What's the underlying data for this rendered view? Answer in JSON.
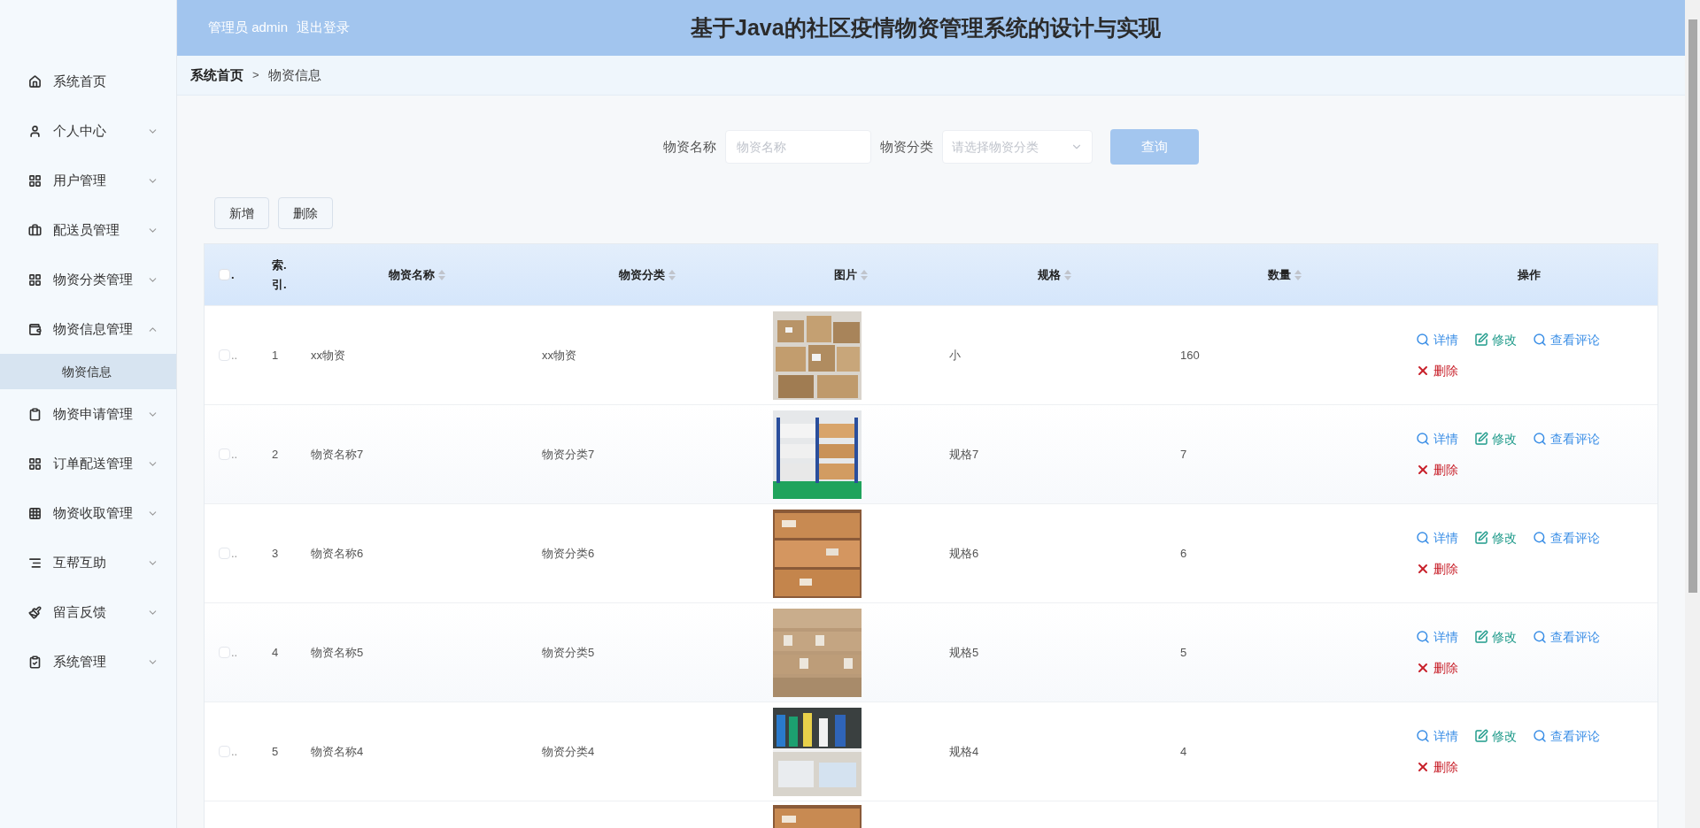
{
  "header": {
    "user_role": "管理员",
    "username": "admin",
    "logout": "退出登录",
    "title": "基于Java的社区疫情物资管理系统的设计与实现"
  },
  "sidebar": {
    "items": [
      {
        "label": "系统首页",
        "kind": "link"
      },
      {
        "label": "个人中心",
        "kind": "menu",
        "expanded": false
      },
      {
        "label": "用户管理",
        "kind": "menu",
        "expanded": false
      },
      {
        "label": "配送员管理",
        "kind": "menu",
        "expanded": false
      },
      {
        "label": "物资分类管理",
        "kind": "menu",
        "expanded": false
      },
      {
        "label": "物资信息管理",
        "kind": "menu",
        "expanded": true,
        "children": [
          {
            "label": "物资信息",
            "selected": true
          }
        ]
      },
      {
        "label": "物资申请管理",
        "kind": "menu",
        "expanded": false
      },
      {
        "label": "订单配送管理",
        "kind": "menu",
        "expanded": false
      },
      {
        "label": "物资收取管理",
        "kind": "menu",
        "expanded": false
      },
      {
        "label": "互帮互助",
        "kind": "menu",
        "expanded": false
      },
      {
        "label": "留言反馈",
        "kind": "menu",
        "expanded": false
      },
      {
        "label": "系统管理",
        "kind": "menu",
        "expanded": false
      }
    ]
  },
  "breadcrumb": {
    "home": "系统首页",
    "separator": ">",
    "current": "物资信息"
  },
  "search": {
    "name_label": "物资名称",
    "name_placeholder": "物资名称",
    "category_label": "物资分类",
    "category_placeholder": "请选择物资分类",
    "query_button": "查询"
  },
  "toolbar": {
    "buttons": [
      "新增",
      "删除"
    ]
  },
  "table": {
    "select_header": ".",
    "select_all_checked": false,
    "index_header_lines": [
      "索.",
      "引."
    ],
    "columns": [
      {
        "label": "物资名称",
        "sortable": true
      },
      {
        "label": "物资分类",
        "sortable": true
      },
      {
        "label": "图片",
        "sortable": true
      },
      {
        "label": "规格",
        "sortable": true
      },
      {
        "label": "数量",
        "sortable": true
      },
      {
        "label": "操作",
        "sortable": false
      }
    ],
    "rows": [
      {
        "checked": false,
        "select_text": "..",
        "index": "1",
        "name": "xx物资",
        "category": "xx物资",
        "picture": {
          "kind": "picture"
        },
        "spec": "小",
        "quantity": "160",
        "actions": [
          {
            "label": "详情",
            "kind": "view"
          },
          {
            "label": "修改",
            "kind": "edit"
          },
          {
            "label": "查看评论",
            "kind": "view"
          },
          {
            "label": "删除",
            "kind": "delete"
          }
        ]
      },
      {
        "checked": false,
        "select_text": "..",
        "index": "2",
        "name": "物资名称7",
        "category": "物资分类7",
        "picture": {
          "kind": "picture"
        },
        "spec": "规格7",
        "quantity": "7",
        "actions": [
          {
            "label": "详情",
            "kind": "view"
          },
          {
            "label": "修改",
            "kind": "edit"
          },
          {
            "label": "查看评论",
            "kind": "view"
          },
          {
            "label": "删除",
            "kind": "delete"
          }
        ]
      },
      {
        "checked": false,
        "select_text": "..",
        "index": "3",
        "name": "物资名称6",
        "category": "物资分类6",
        "picture": {
          "kind": "picture"
        },
        "spec": "规格6",
        "quantity": "6",
        "actions": [
          {
            "label": "详情",
            "kind": "view"
          },
          {
            "label": "修改",
            "kind": "edit"
          },
          {
            "label": "查看评论",
            "kind": "view"
          },
          {
            "label": "删除",
            "kind": "delete"
          }
        ]
      },
      {
        "checked": false,
        "select_text": "..",
        "index": "4",
        "name": "物资名称5",
        "category": "物资分类5",
        "picture": {
          "kind": "picture"
        },
        "spec": "规格5",
        "quantity": "5",
        "actions": [
          {
            "label": "详情",
            "kind": "view"
          },
          {
            "label": "修改",
            "kind": "edit"
          },
          {
            "label": "查看评论",
            "kind": "view"
          },
          {
            "label": "删除",
            "kind": "delete"
          }
        ]
      },
      {
        "checked": false,
        "select_text": "..",
        "index": "5",
        "name": "物资名称4",
        "category": "物资分类4",
        "picture": {
          "kind": "picture"
        },
        "spec": "规格4",
        "quantity": "4",
        "actions": [
          {
            "label": "详情",
            "kind": "view"
          },
          {
            "label": "修改",
            "kind": "edit"
          },
          {
            "label": "查看评论",
            "kind": "view"
          },
          {
            "label": "删除",
            "kind": "delete"
          }
        ]
      }
    ],
    "partial_row": {
      "picture": {
        "kind": "picture"
      }
    }
  }
}
